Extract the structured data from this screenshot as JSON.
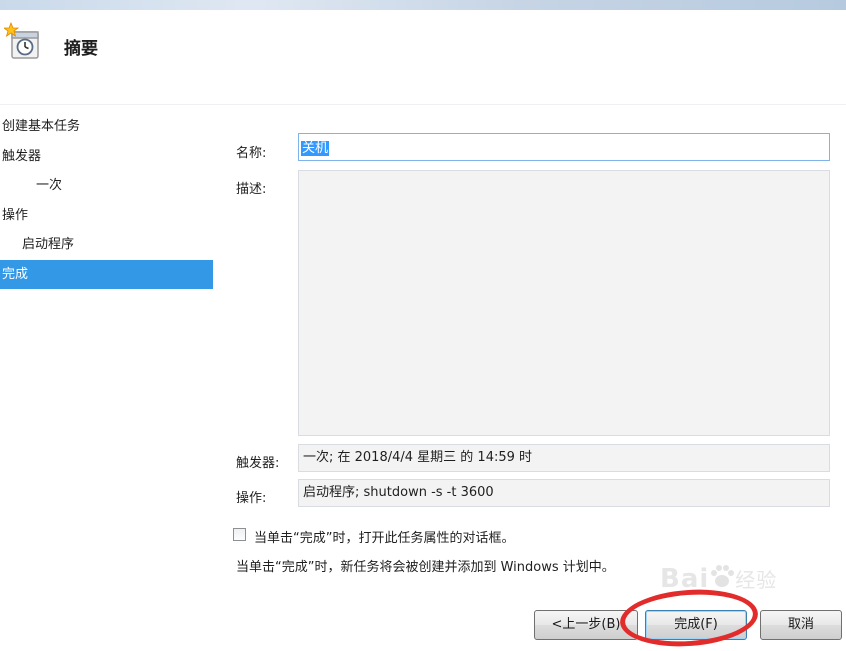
{
  "page_title": "摘要",
  "steps": [
    {
      "label": "创建基本任务",
      "level": 0,
      "active": false
    },
    {
      "label": "触发器",
      "level": 0,
      "active": false
    },
    {
      "label": "一次",
      "level": 2,
      "active": false
    },
    {
      "label": "操作",
      "level": 0,
      "active": false
    },
    {
      "label": "启动程序",
      "level": 1,
      "active": false
    },
    {
      "label": "完成",
      "level": 0,
      "active": true
    }
  ],
  "form": {
    "name_label": "名称:",
    "name_value": "关机",
    "description_label": "描述:",
    "description_value": "",
    "trigger_label": "触发器:",
    "trigger_value": "一次; 在 2018/4/4 星期三 的 14:59 时",
    "action_label": "操作:",
    "action_value": "启动程序; shutdown -s -t 3600"
  },
  "options": {
    "open_properties_label": "当单击“完成”时，打开此任务属性的对话框。",
    "open_properties_checked": false,
    "info_text": "当单击“完成”时，新任务将会被创建并添加到 Windows 计划中。"
  },
  "buttons": {
    "back_label": "<上一步(B)",
    "finish_label": "完成(F)",
    "cancel_label": "取消"
  },
  "watermark": {
    "brand": "Bai",
    "suffix": "经验"
  },
  "colors": {
    "selection": "#3399e6",
    "annotation": "#e22b2b"
  }
}
